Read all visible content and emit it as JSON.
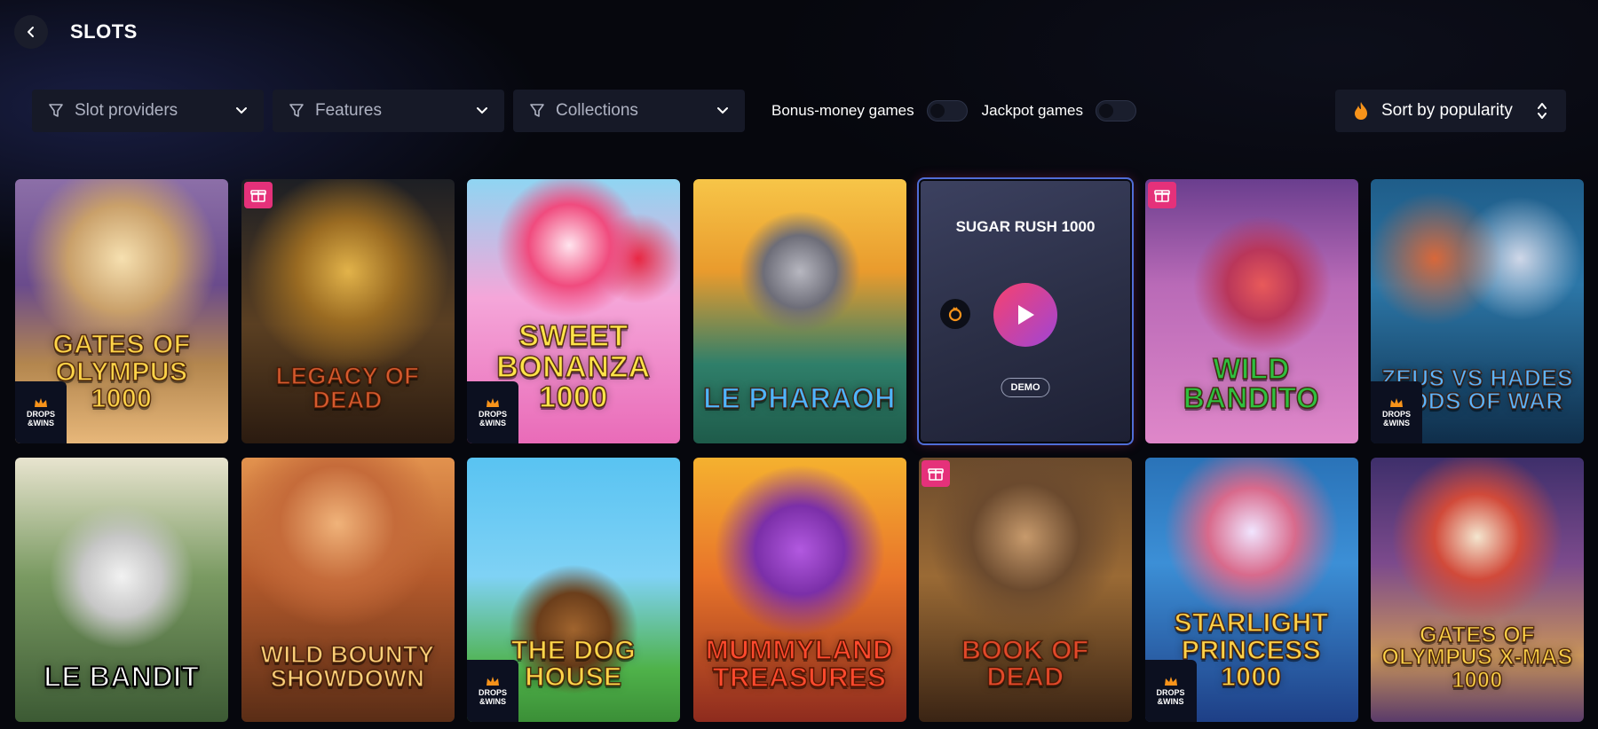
{
  "header": {
    "title": "SLOTS",
    "back_icon": "chevron-left-icon"
  },
  "filters": {
    "dropdowns": [
      {
        "label": "Slot providers",
        "icon": "filter-icon"
      },
      {
        "label": "Features",
        "icon": "filter-icon"
      },
      {
        "label": "Collections",
        "icon": "filter-icon"
      }
    ],
    "toggles": [
      {
        "label": "Bonus-money games",
        "on": false
      },
      {
        "label": "Jackpot games",
        "on": false
      }
    ],
    "sort": {
      "label": "Sort by popularity",
      "icon": "flame-icon",
      "accent": "#f7931a"
    }
  },
  "badges": {
    "drops": "DROPS &WINS"
  },
  "games": [
    {
      "name": "Gates of Olympus 1000",
      "gift": false,
      "drops": true
    },
    {
      "name": "Legacy of Dead",
      "gift": true,
      "drops": false
    },
    {
      "name": "Sweet Bonanza 1000",
      "gift": false,
      "drops": true
    },
    {
      "name": "Le Pharaoh",
      "gift": false,
      "drops": false
    },
    {
      "name": "SUGAR RUSH 1000",
      "gift": false,
      "drops": false,
      "active": true,
      "demo_label": "DEMO"
    },
    {
      "name": "Wild Bandito",
      "gift": true,
      "drops": false
    },
    {
      "name": "Zeus vs Hades Gods of War",
      "gift": false,
      "drops": true
    },
    {
      "name": "Le Bandit",
      "gift": false,
      "drops": false
    },
    {
      "name": "Wild Bounty Showdown",
      "gift": false,
      "drops": false
    },
    {
      "name": "The Dog House",
      "gift": false,
      "drops": true
    },
    {
      "name": "Mummyland Treasures",
      "gift": false,
      "drops": false
    },
    {
      "name": "Book of Dead",
      "gift": true,
      "drops": false
    },
    {
      "name": "Starlight Princess 1000",
      "gift": false,
      "drops": true
    },
    {
      "name": "Gates of Olympus X-mas 1000",
      "gift": false,
      "drops": false
    }
  ],
  "colors": {
    "gift_badge": "#e5317a",
    "play_gradient_start": "#f7416e",
    "play_gradient_end": "#9f45d6"
  }
}
